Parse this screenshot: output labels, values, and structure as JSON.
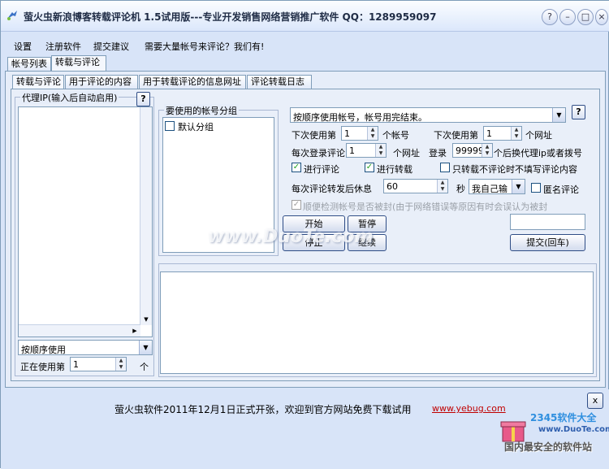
{
  "window": {
    "title": "萤火虫新浪博客转载评论机 1.5试用版---专业开发销售网络营销推广软件 QQ：1289959097"
  },
  "window_buttons": {
    "help": "?",
    "minimize": "–",
    "maximize": "□",
    "close": "×"
  },
  "menu": {
    "items": [
      "设置",
      "注册软件",
      "提交建议",
      "需要大量帐号来评论？我们有!"
    ]
  },
  "top_tabs": [
    "帐号列表",
    "转载与评论"
  ],
  "sub_tabs": [
    "转载与评论",
    "用于评论的内容",
    "用于转载评论的信息网址",
    "评论转载日志"
  ],
  "proxy": {
    "group_label": "代理IP(输入后自动启用)",
    "help": "?",
    "mode": "按顺序使用",
    "using_label": "正在使用第",
    "using_value": "1",
    "using_unit": "个"
  },
  "account_group": {
    "label": "要使用的帐号分组",
    "items": [
      {
        "label": "默认分组",
        "checked": false
      }
    ]
  },
  "settings": {
    "mode_select": "按顺序使用帐号，帐号用完结束。",
    "help": "?",
    "next_account_label": "下次使用第",
    "next_account_value": "1",
    "next_account_unit": "个帐号",
    "next_url_label": "下次使用第",
    "next_url_value": "1",
    "next_url_unit": "个网址",
    "per_login_label": "每次登录评论",
    "per_login_value": "1",
    "per_login_unit": "个网址",
    "login_label": "登录",
    "login_value": "99999",
    "login_suffix": "个后换代理ip或者拨号",
    "cb_comment": {
      "label": "进行评论",
      "checked": true
    },
    "cb_repost": {
      "label": "进行转载",
      "checked": true
    },
    "cb_repost_only": {
      "label": "只转载不评论时不填写评论内容",
      "checked": false
    },
    "rest_label": "每次评论转发后休息",
    "rest_value": "60",
    "rest_unit": "秒",
    "self_input_select": "我自己输",
    "cb_anonymous": {
      "label": "匿名评论",
      "checked": false
    },
    "cb_detect": {
      "label": "顺便检测帐号是否被封(由于网络错误等原因有时会误认为被封",
      "checked": true
    }
  },
  "buttons": {
    "start": "开始",
    "pause": "暂停",
    "stop": "停止",
    "continue": "继续",
    "submit": "提交(回车)"
  },
  "status": {
    "message": "萤火虫软件2011年12月1日正式开张，欢迎到官方网站免费下载试用",
    "link": "www.yebug.com",
    "close": "x"
  },
  "watermarks": {
    "center": "www.DuoTe.com",
    "badge_title": "2345软件大全",
    "badge_url": "www.DuoTe.com",
    "badge_slogan": "国内最安全的软件站"
  }
}
